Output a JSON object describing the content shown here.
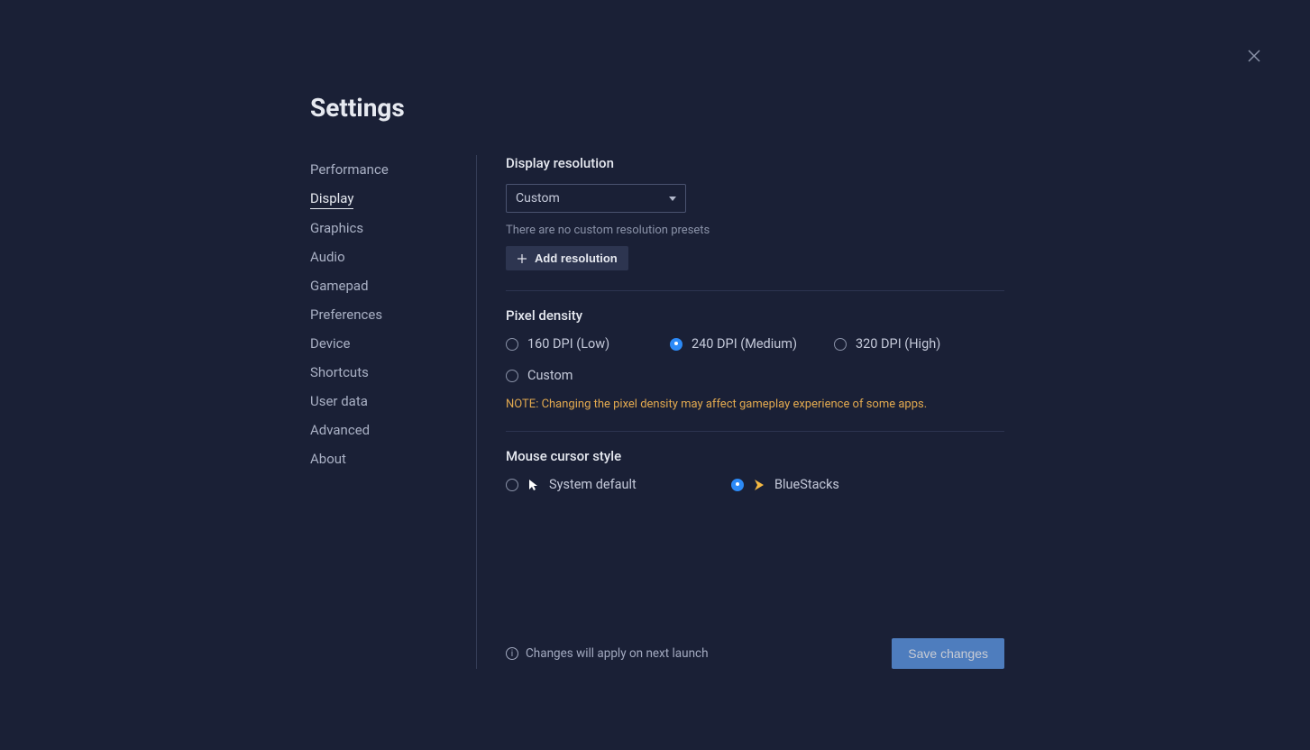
{
  "page_title": "Settings",
  "sidebar": {
    "items": [
      {
        "label": "Performance",
        "active": false
      },
      {
        "label": "Display",
        "active": true
      },
      {
        "label": "Graphics",
        "active": false
      },
      {
        "label": "Audio",
        "active": false
      },
      {
        "label": "Gamepad",
        "active": false
      },
      {
        "label": "Preferences",
        "active": false
      },
      {
        "label": "Device",
        "active": false
      },
      {
        "label": "Shortcuts",
        "active": false
      },
      {
        "label": "User data",
        "active": false
      },
      {
        "label": "Advanced",
        "active": false
      },
      {
        "label": "About",
        "active": false
      }
    ]
  },
  "display_resolution": {
    "title": "Display resolution",
    "selected": "Custom",
    "helper": "There are no custom resolution presets",
    "add_button": "Add resolution"
  },
  "pixel_density": {
    "title": "Pixel density",
    "options": [
      {
        "label": "160 DPI (Low)",
        "checked": false
      },
      {
        "label": "240 DPI (Medium)",
        "checked": true
      },
      {
        "label": "320 DPI (High)",
        "checked": false
      },
      {
        "label": "Custom",
        "checked": false
      }
    ],
    "note": "NOTE: Changing the pixel density may affect gameplay experience of some apps."
  },
  "mouse_cursor": {
    "title": "Mouse cursor style",
    "options": [
      {
        "label": "System default",
        "checked": false,
        "icon": "system"
      },
      {
        "label": "BlueStacks",
        "checked": true,
        "icon": "bluestacks"
      }
    ]
  },
  "footer": {
    "message": "Changes will apply on next launch",
    "save": "Save changes"
  }
}
